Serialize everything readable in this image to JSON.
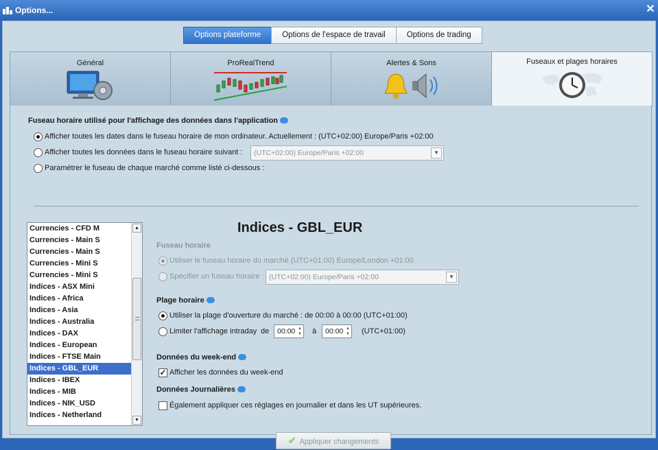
{
  "window": {
    "title": "Options...",
    "close_icon": "close-icon"
  },
  "top_tabs": [
    {
      "label": "Options plateforme",
      "active": true
    },
    {
      "label": "Options de l'espace de travail",
      "active": false
    },
    {
      "label": "Options de trading",
      "active": false
    }
  ],
  "category_tabs": [
    {
      "label": "Général",
      "icon": "monitor-gear-icon",
      "active": false
    },
    {
      "label": "ProRealTrend",
      "icon": "trend-chart-icon",
      "active": false
    },
    {
      "label": "Alertes & Sons",
      "icon": "bell-speaker-icon",
      "active": false
    },
    {
      "label": "Fuseaux et plages horaires",
      "icon": "world-clock-icon",
      "active": true
    }
  ],
  "timezone_section": {
    "heading": "Fuseau horaire utilisé pour l'affichage des données dans l'application",
    "option_computer": "Afficher toutes les dates dans le fuseau horaire de mon ordinateur. Actuellement : (UTC+02:00) Europe/Paris +02:00",
    "option_following": "Afficher toutes les données dans le fuseau horaire suivant :",
    "option_following_value": "(UTC+02:00) Europe/Paris +02:00",
    "option_per_market": "Paramétrer le fuseau de chaque marché comme listé ci-dessous :",
    "selected": "computer"
  },
  "market_list": {
    "items": [
      "Currencies - CFD M",
      "Currencies - Main S",
      "Currencies - Main S",
      "Currencies - Mini S",
      "Currencies - Mini S",
      "Indices - ASX Mini",
      "Indices - Africa",
      "Indices - Asia",
      "Indices - Australia",
      "Indices - DAX",
      "Indices - European",
      "Indices - FTSE Main",
      "Indices - GBL_EUR",
      "Indices - IBEX",
      "Indices - MIB",
      "Indices - NIK_USD",
      "Indices - Netherland"
    ],
    "selected": "Indices - GBL_EUR"
  },
  "market_detail": {
    "title": "Indices - GBL_EUR",
    "timezone_heading": "Fuseau horaire",
    "use_market_tz": "Utiliser le fuseau horaire du marché (UTC+01:00) Europe/London +01:00",
    "specify_tz": "Spécifier un fuseau horaire :",
    "specify_tz_value": "(UTC+02:00) Europe/Paris +02:00",
    "hours_heading": "Plage horaire",
    "use_market_hours": "Utiliser la plage d'ouverture du marché : de 00:00 à 00:00  (UTC+01:00)",
    "limit_intraday": "Limiter l'affichage intraday",
    "limit_from_label": "de",
    "limit_from": "00:00",
    "limit_to_label": "à",
    "limit_to": "00:00",
    "limit_tz": "(UTC+01:00)",
    "weekend_heading": "Données du week-end",
    "show_weekend": "Afficher les données du week-end",
    "show_weekend_checked": true,
    "daily_heading": "Données Journalières",
    "apply_daily": "Également appliquer ces réglages en journalier et dans les UT supérieures.",
    "apply_daily_checked": false
  },
  "apply_button": "Appliquer changements"
}
